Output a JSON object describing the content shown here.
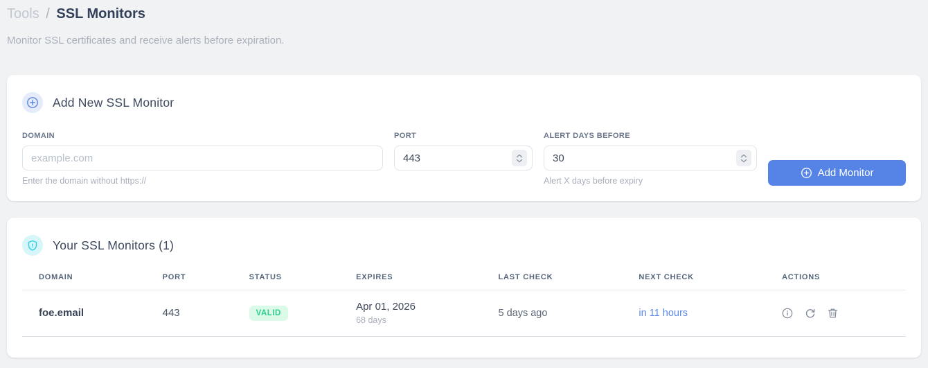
{
  "breadcrumb": {
    "section": "Tools",
    "separator": "/",
    "page": "SSL Monitors"
  },
  "subtitle": "Monitor SSL certificates and receive alerts before expiration.",
  "add_card": {
    "title": "Add New SSL Monitor",
    "fields": {
      "domain": {
        "label": "DOMAIN",
        "value": "",
        "placeholder": "example.com",
        "helper": "Enter the domain without https://"
      },
      "port": {
        "label": "PORT",
        "value": "443"
      },
      "alert_days": {
        "label": "ALERT DAYS BEFORE",
        "value": "30",
        "helper": "Alert X days before expiry"
      }
    },
    "submit_label": "Add Monitor"
  },
  "monitors_card": {
    "title": "Your SSL Monitors (1)",
    "table": {
      "columns": [
        "DOMAIN",
        "PORT",
        "STATUS",
        "EXPIRES",
        "LAST CHECK",
        "NEXT CHECK",
        "ACTIONS"
      ],
      "rows": [
        {
          "domain": "foe.email",
          "port": "443",
          "status": "VALID",
          "expires_date": "Apr 01, 2026",
          "expires_days": "68 days",
          "last_check": "5 days ago",
          "next_check": "in 11 hours"
        }
      ]
    }
  },
  "icons": {
    "add_card_header": "plus-circle-icon",
    "submit_button": "plus-circle-icon",
    "monitors_card_header": "shield-icon",
    "row_actions": [
      "info-icon",
      "refresh-icon",
      "trash-icon"
    ]
  },
  "colors": {
    "accent_blue": "#5584e6",
    "link_blue": "#5b87e8",
    "badge_green_text": "#2fcc8e",
    "badge_green_bg": "#dbfbe8",
    "shield_cyan": "#2fd0e4",
    "page_bg": "#f1f2f4"
  }
}
